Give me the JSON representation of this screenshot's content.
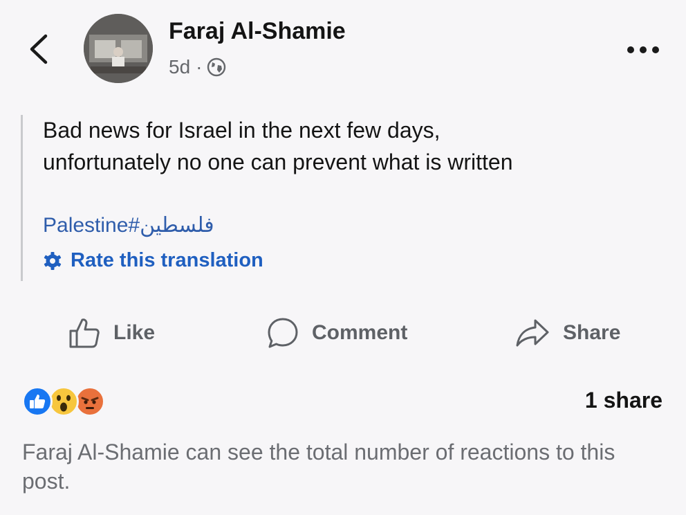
{
  "post": {
    "author": "Faraj Al-Shamie",
    "time": "5d",
    "separator": "·",
    "visibility_icon": "globe-icon",
    "text_lines": [
      "Bad news for Israel in the next few days,",
      "unfortunately no one can prevent what is written"
    ],
    "hashtag": "Palestine#فلسطين",
    "rate_translation": "Rate this translation"
  },
  "actions": {
    "like": "Like",
    "comment": "Comment",
    "share": "Share"
  },
  "stats": {
    "reactions": [
      "like-reaction-icon",
      "wow-reaction-icon",
      "angry-reaction-icon"
    ],
    "shares": "1 share"
  },
  "notice": "Faraj Al-Shamie can see the total number of reactions to this post.",
  "colors": {
    "background": "#f7f6f8",
    "link": "#2f5dab",
    "rate_link": "#1f5fc0",
    "secondary_text": "#65676b",
    "like_blue": "#1877f2",
    "wow_yellow": "#f7c63e",
    "angry_orange": "#e9713c"
  }
}
